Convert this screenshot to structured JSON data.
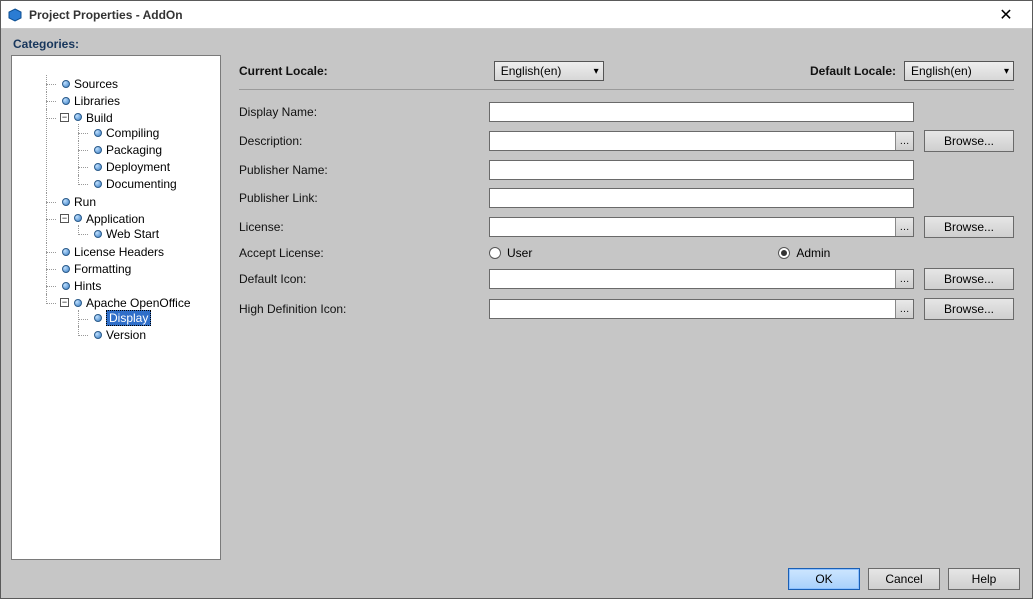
{
  "window": {
    "title": "Project Properties - AddOn",
    "close": "✕"
  },
  "categories_heading": "Categories:",
  "tree": {
    "sources": "Sources",
    "libraries": "Libraries",
    "build": "Build",
    "compiling": "Compiling",
    "packaging": "Packaging",
    "deployment": "Deployment",
    "documenting": "Documenting",
    "run": "Run",
    "application": "Application",
    "web_start": "Web Start",
    "license_headers": "License Headers",
    "formatting": "Formatting",
    "hints": "Hints",
    "apache_oo": "Apache OpenOffice",
    "display": "Display",
    "version": "Version"
  },
  "locale": {
    "current_label": "Current Locale:",
    "current_value": "English(en)",
    "default_label": "Default Locale:",
    "default_value": "English(en)"
  },
  "form": {
    "display_name": "Display Name:",
    "description": "Description:",
    "publisher_name": "Publisher Name:",
    "publisher_link": "Publisher Link:",
    "license": "License:",
    "accept_license": "Accept License:",
    "user": "User",
    "admin": "Admin",
    "default_icon": "Default Icon:",
    "hd_icon": "High Definition Icon:",
    "browse": "Browse..."
  },
  "values": {
    "display_name": "",
    "description": "",
    "publisher_name": "",
    "publisher_link": "",
    "license": "",
    "default_icon": "",
    "hd_icon": ""
  },
  "buttons": {
    "ok": "OK",
    "cancel": "Cancel",
    "help": "Help"
  }
}
